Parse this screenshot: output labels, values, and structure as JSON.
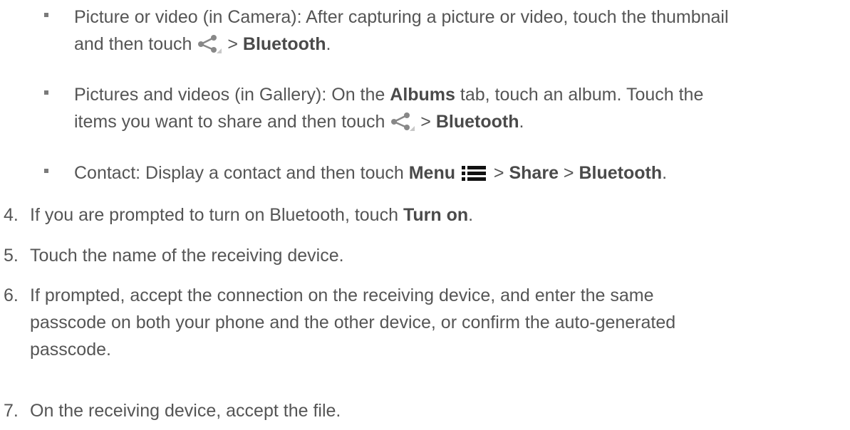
{
  "bullets": [
    {
      "line1": "Picture or video (in Camera): After capturing a picture or video, touch the thumbnail",
      "line2_prefix": "and then touch",
      "sep": ">",
      "target": "Bluetooth",
      "end": ".",
      "icon": "share-icon"
    },
    {
      "line1_prefix": "Pictures and videos (in Gallery): On the",
      "albums": "Albums",
      "line1_suffix": "tab, touch an album. Touch the",
      "line2_prefix": "items you want to share and then touch",
      "sep": ">",
      "target": "Bluetooth",
      "end": ".",
      "icon": "share-icon"
    },
    {
      "prefix": "Contact: Display a contact and then touch",
      "menu": "Menu",
      "sep1": ">",
      "share": "Share",
      "sep2": ">",
      "target": "Bluetooth",
      "end": ".",
      "icon": "menu-icon"
    }
  ],
  "steps": [
    {
      "num": "4.",
      "prefix": "If you are prompted to turn on Bluetooth, touch",
      "bold": "Turn on",
      "end": "."
    },
    {
      "num": "5.",
      "text": "Touch the name of the receiving device."
    },
    {
      "num": "6.",
      "line1": "If prompted, accept the connection on the receiving device, and enter the same",
      "line2": "passcode on both your phone and the other device, or confirm the auto-generated",
      "line3": "passcode."
    },
    {
      "num": "7.",
      "text": "On the receiving device, accept the file."
    }
  ]
}
